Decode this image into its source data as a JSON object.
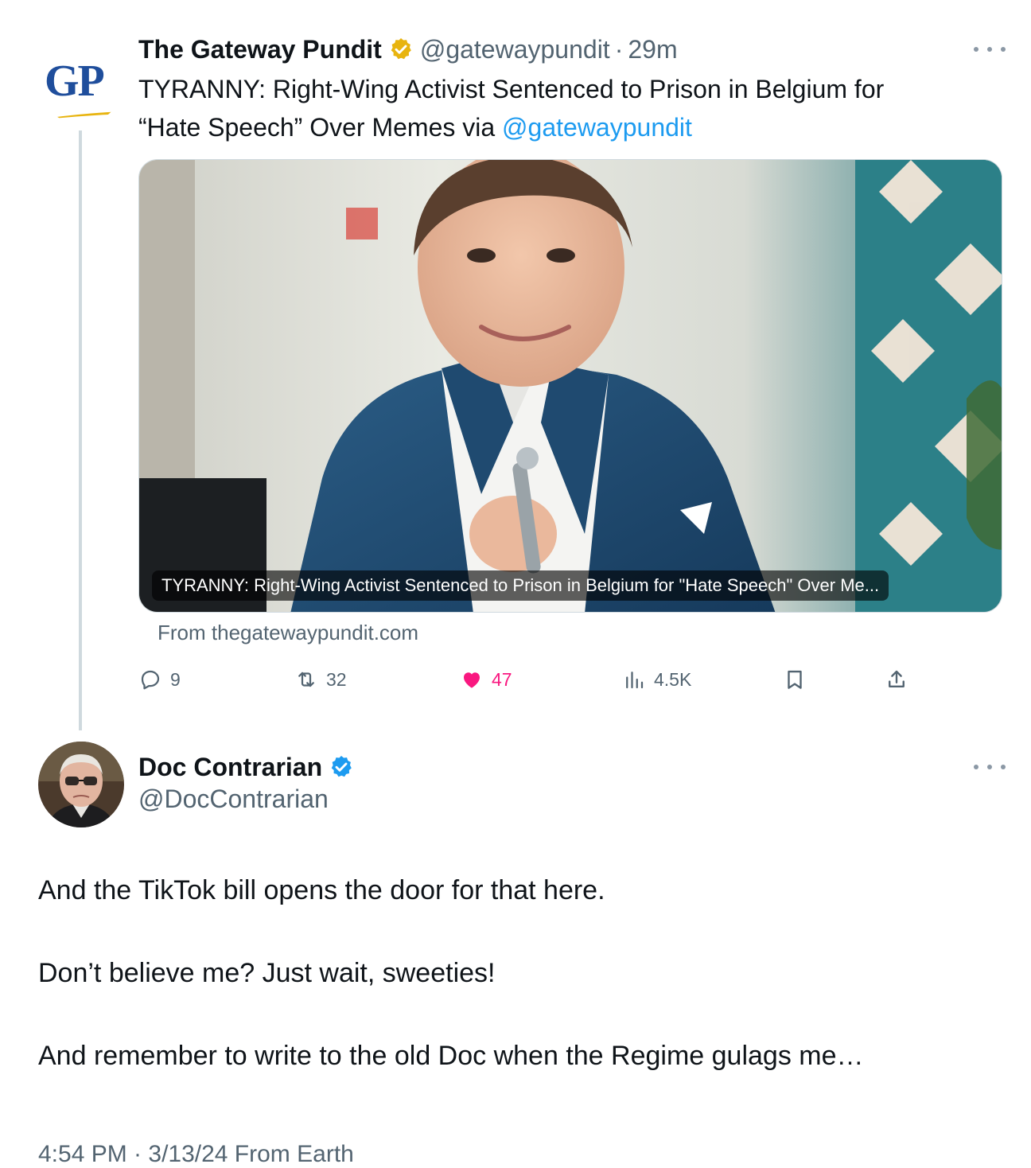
{
  "parent_tweet": {
    "author_name": "The Gateway Pundit",
    "handle": "@gatewaypundit",
    "separator": "·",
    "time": "29m",
    "avatar_text": "GP",
    "text_line1": "TYRANNY: Right-Wing Activist Sentenced to Prison in Belgium for",
    "text_line2_prefix": "“Hate Speech” Over Memes via ",
    "text_line2_link": "@gatewaypundit",
    "card": {
      "caption": "TYRANNY: Right-Wing Activist Sentenced to Prison in Belgium for \"Hate Speech\" Over Me...",
      "source": "From thegatewaypundit.com"
    },
    "actions": {
      "replies": "9",
      "reposts": "32",
      "likes": "47",
      "views": "4.5K"
    }
  },
  "main_tweet": {
    "author_name": "Doc Contrarian",
    "handle": "@DocContrarian",
    "line1": "And the TikTok bill opens the door for that here.",
    "line2": "Don’t believe me? Just wait, sweeties!",
    "line3": "And remember to write to the old Doc when the Regime gulags me…",
    "meta": "4:54 PM · 3/13/24 From Earth"
  },
  "colors": {
    "link": "#1d9bf0",
    "like": "#f91880",
    "secondary_text": "#536471",
    "verified_gold": "#e8b40f",
    "verified_blue": "#1d9bf0"
  },
  "icons": [
    "reply-icon",
    "repost-icon",
    "heart-icon",
    "views-icon",
    "bookmark-icon",
    "share-icon",
    "more-icon",
    "verified-badge-icon"
  ]
}
